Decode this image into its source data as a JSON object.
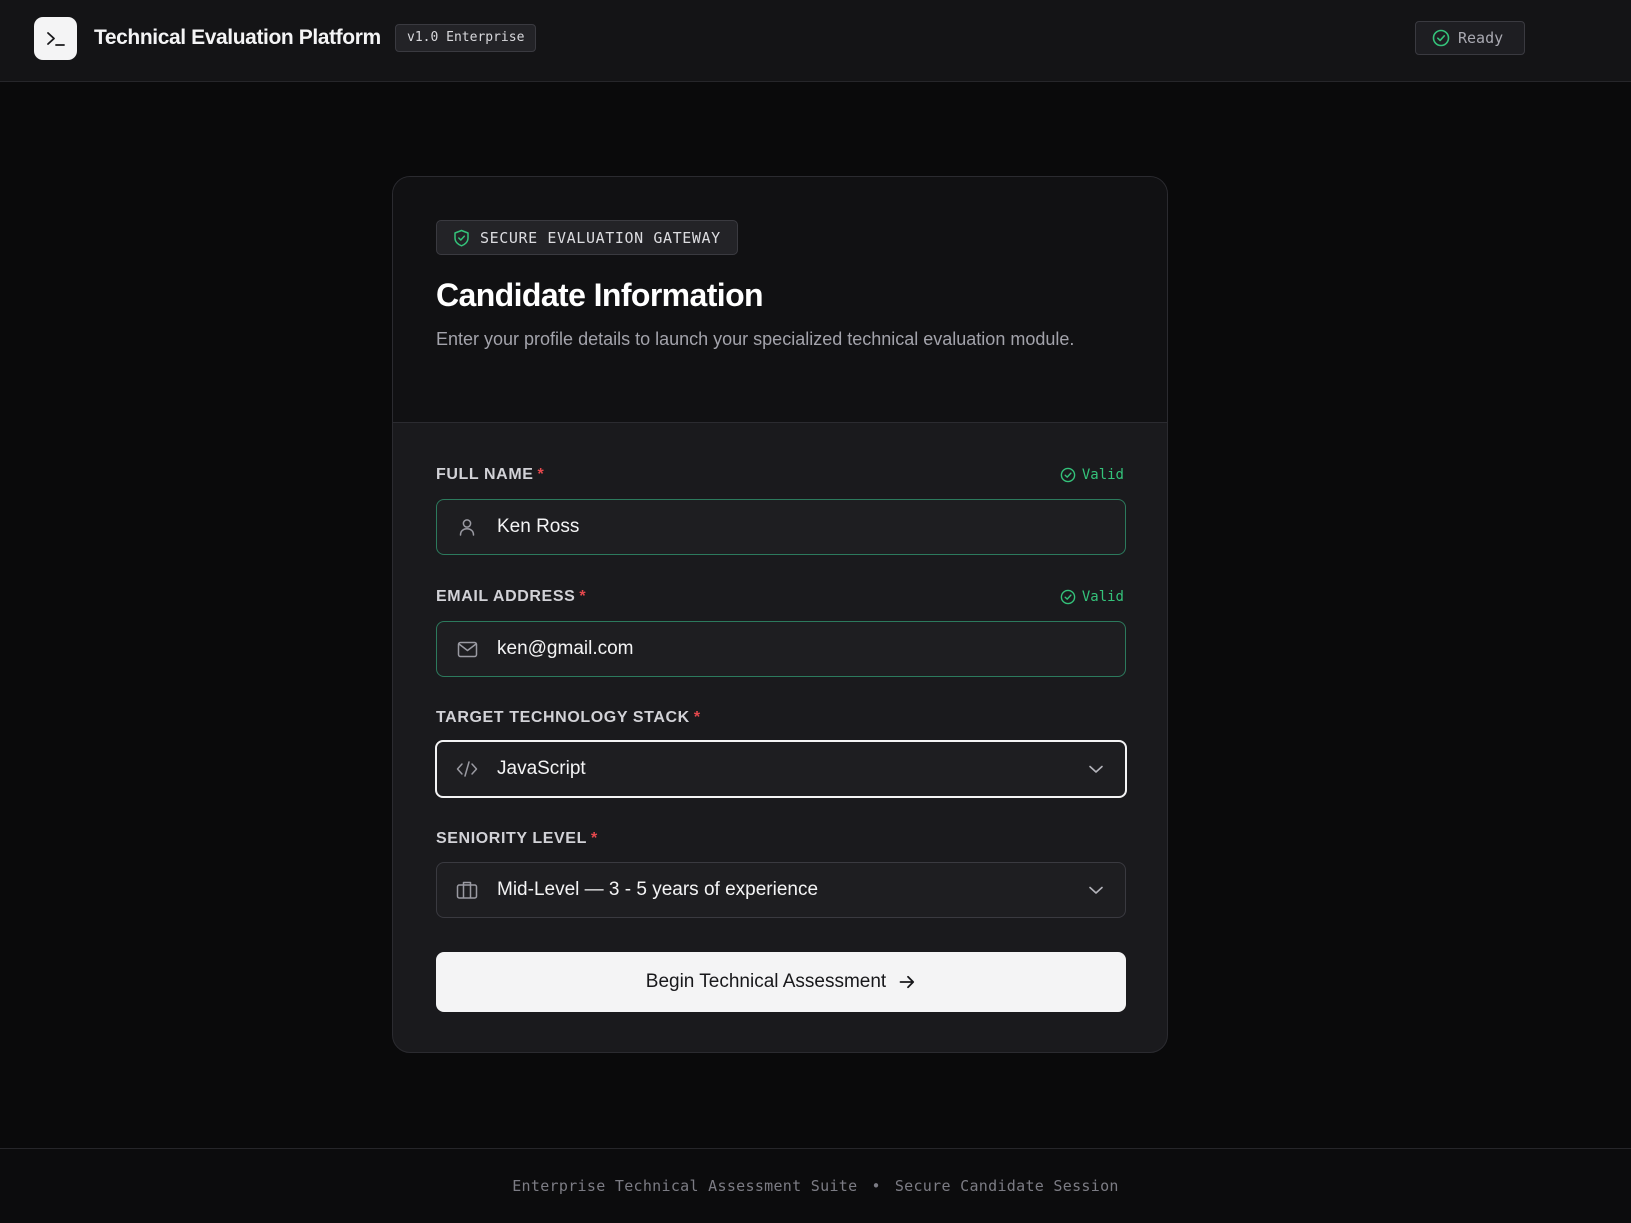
{
  "app": {
    "title": "Technical Evaluation Platform",
    "version": "v1.0 Enterprise",
    "status": "Ready",
    "logo_icon": "terminal-prompt-icon"
  },
  "card": {
    "badge": "SECURE EVALUATION GATEWAY",
    "title": "Candidate Information",
    "subtitle": "Enter your profile details to launch your specialized technical evaluation module."
  },
  "form": {
    "full_name": {
      "label": "FULL NAME",
      "required": "*",
      "valid": "Valid",
      "value": "Ken Ross",
      "icon": "user-icon"
    },
    "email": {
      "label": "EMAIL ADDRESS",
      "required": "*",
      "valid": "Valid",
      "value": "ken@gmail.com",
      "icon": "mail-icon"
    },
    "stack": {
      "label": "TARGET TECHNOLOGY STACK",
      "required": "*",
      "value": "JavaScript",
      "icon": "code-icon"
    },
    "seniority": {
      "label": "SENIORITY LEVEL",
      "required": "*",
      "value": "Mid-Level — 3 - 5 years of experience",
      "icon": "briefcase-icon"
    },
    "submit": "Begin Technical Assessment"
  },
  "footer": {
    "left": "Enterprise Technical Assessment Suite",
    "separator": "•",
    "right": "Secure Candidate Session"
  },
  "colors": {
    "background": "#0a0a0b",
    "valid": "#34c27a",
    "required": "#e5484d",
    "primary_button": "#f4f4f5"
  }
}
